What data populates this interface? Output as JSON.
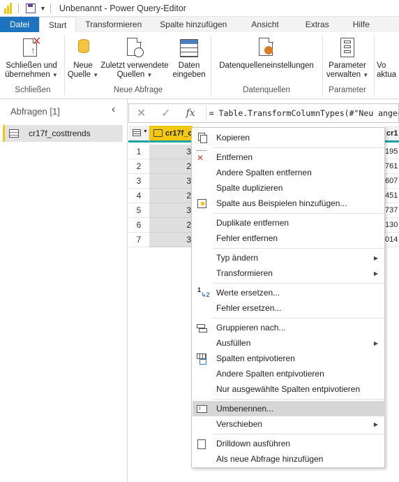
{
  "window": {
    "title": "Unbenannt - Power Query-Editor"
  },
  "tabs": [
    {
      "label": "Datei"
    },
    {
      "label": "Start"
    },
    {
      "label": "Transformieren"
    },
    {
      "label": "Spalte hinzufügen"
    },
    {
      "label": "Ansicht"
    },
    {
      "label": "Extras"
    },
    {
      "label": "Hilfe"
    }
  ],
  "ribbon": {
    "close_apply": {
      "line1": "Schließen und",
      "line2": "übernehmen"
    },
    "new_source": {
      "line1": "Neue",
      "line2": "Quelle"
    },
    "recent_sources": {
      "line1": "Zuletzt verwendete",
      "line2": "Quellen"
    },
    "enter_data": {
      "line1": "Daten",
      "line2": "eingeben"
    },
    "data_source_settings": {
      "line1": "Datenquelleneinstellungen"
    },
    "manage_parameters": {
      "line1": "Parameter",
      "line2": "verwalten"
    },
    "preview_refresh": {
      "line1": "Vo",
      "line2": "aktua"
    },
    "groups": {
      "close": "Schließen",
      "new_query": "Neue Abfrage",
      "data_sources": "Datenquellen",
      "parameters": "Parameter"
    }
  },
  "queries": {
    "header": "Abfragen [1]",
    "items": [
      {
        "label": "cr17f_costtrends"
      }
    ]
  },
  "formula_bar": {
    "text": "= Table.TransformColumnTypes(#\"Neu angeo"
  },
  "grid": {
    "column1_header": "cr17f_c",
    "column2_header": "cr1",
    "row_numbers": [
      "1",
      "2",
      "3",
      "4",
      "5",
      "6",
      "7"
    ],
    "column1_values": [
      "3",
      "2",
      "3",
      "2",
      "3",
      "2",
      "3"
    ],
    "column2_values": [
      "195",
      "761",
      "607",
      "451",
      "737",
      "130",
      "014"
    ]
  },
  "context_menu": {
    "items": [
      {
        "label": "Kopieren",
        "icon": "copy-icon"
      },
      {
        "label": "Entfernen",
        "icon": "remove-icon"
      },
      {
        "label": "Andere Spalten entfernen"
      },
      {
        "label": "Spalte duplizieren"
      },
      {
        "label": "Spalte aus Beispielen hinzufügen...",
        "icon": "add-from-examples-icon"
      },
      {
        "label": "Duplikate entfernen"
      },
      {
        "label": "Fehler entfernen"
      },
      {
        "label": "Typ ändern",
        "submenu": true
      },
      {
        "label": "Transformieren",
        "submenu": true
      },
      {
        "label": "Werte ersetzen...",
        "icon": "replace-values-icon"
      },
      {
        "label": "Fehler ersetzen..."
      },
      {
        "label": "Gruppieren nach...",
        "icon": "group-by-icon"
      },
      {
        "label": "Ausfüllen",
        "submenu": true
      },
      {
        "label": "Spalten entpivotieren",
        "icon": "unpivot-icon"
      },
      {
        "label": "Andere Spalten entpivotieren"
      },
      {
        "label": "Nur ausgewählte Spalten entpivotieren"
      },
      {
        "label": "Umbenennen...",
        "icon": "rename-icon",
        "highlighted": true
      },
      {
        "label": "Verschieben",
        "submenu": true
      },
      {
        "label": "Drilldown ausführen",
        "icon": "drilldown-icon"
      },
      {
        "label": "Als neue Abfrage hinzufügen"
      }
    ]
  },
  "colors": {
    "accent": "#1e73be",
    "brand_yellow": "#f2c811",
    "column_indicator": "#1aa3a0",
    "highlight": "#d6d6d6"
  }
}
